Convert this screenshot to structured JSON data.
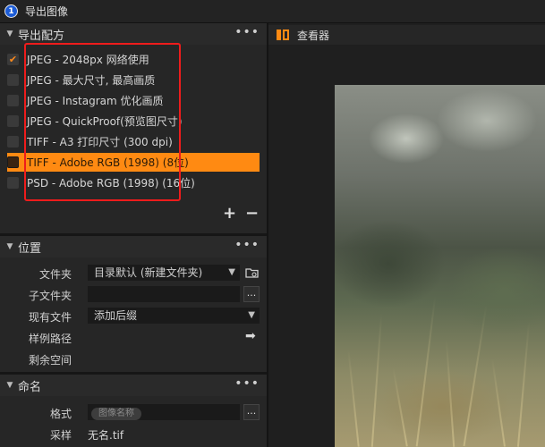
{
  "window": {
    "title": "导出图像",
    "logo_char": "1"
  },
  "recipes_section": {
    "title": "导出配方",
    "more": "•••"
  },
  "recipes": [
    {
      "label": "JPEG - 2048px 网络使用",
      "checked": true,
      "selected": false
    },
    {
      "label": "JPEG - 最大尺寸, 最高画质",
      "checked": false,
      "selected": false
    },
    {
      "label": "JPEG - Instagram 优化画质",
      "checked": false,
      "selected": false
    },
    {
      "label": "JPEG - QuickProof(预览图尺寸)",
      "checked": false,
      "selected": false
    },
    {
      "label": "TIFF - A3 打印尺寸 (300 dpi)",
      "checked": false,
      "selected": false
    },
    {
      "label": "TIFF - Adobe RGB (1998) (8位)",
      "checked": false,
      "selected": true
    },
    {
      "label": "PSD - Adobe RGB (1998) (16位)",
      "checked": false,
      "selected": false
    }
  ],
  "recipe_actions": {
    "add": "+",
    "remove": "−"
  },
  "location_section": {
    "title": "位置",
    "more": "•••",
    "folder_label": "文件夹",
    "folder_value": "目录默认 (新建文件夹)",
    "subfolder_label": "子文件夹",
    "subfolder_value": "",
    "browse": "...",
    "existing_label": "现有文件",
    "existing_value": "添加后缀",
    "sample_path_label": "样例路径",
    "sample_path_arrow": "➡",
    "free_space_label": "剩余空间"
  },
  "naming_section": {
    "title": "命名",
    "more": "•••",
    "format_label": "格式",
    "format_token": "图像名称",
    "browse": "...",
    "sample_label": "采样",
    "sample_value": "无名.tif"
  },
  "viewer": {
    "title": "查看器"
  },
  "colors": {
    "accent": "#ff8a12",
    "annotation": "#ee1c1c"
  }
}
